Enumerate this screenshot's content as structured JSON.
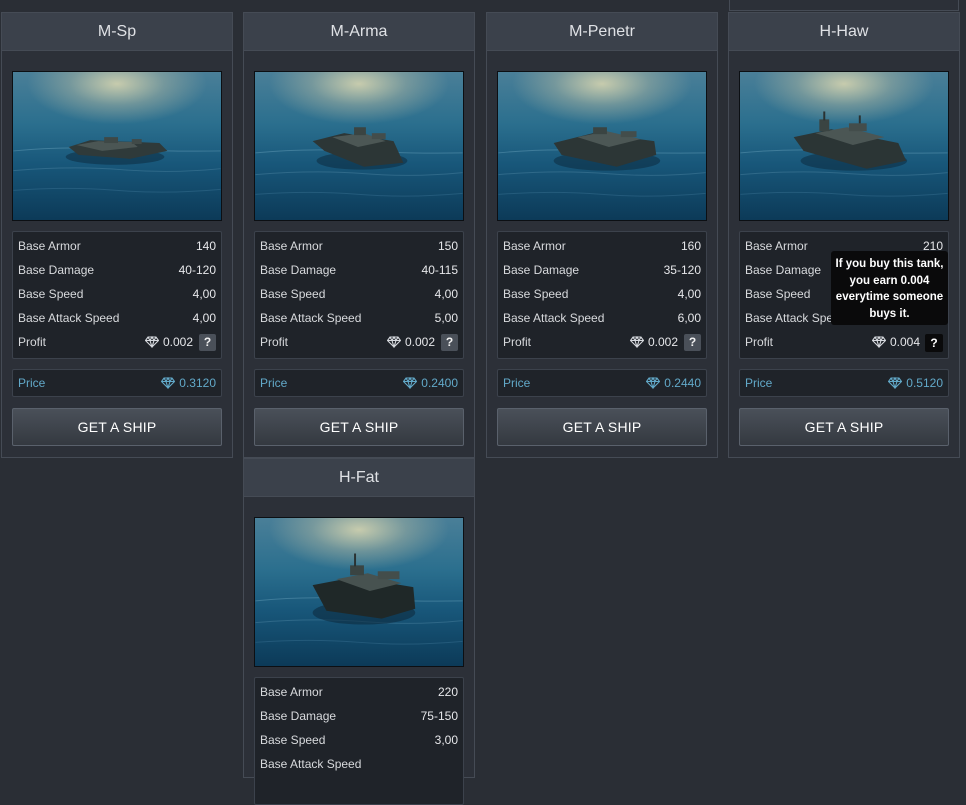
{
  "labels": {
    "base_armor": "Base Armor",
    "base_damage": "Base Damage",
    "base_speed": "Base Speed",
    "base_attack_speed": "Base Attack Speed",
    "profit": "Profit",
    "price": "Price",
    "help": "?",
    "buy_button": "GET A SHIP"
  },
  "icons": {
    "currency": "diamond-icon",
    "help": "question-mark-icon"
  },
  "colors": {
    "price": "#62a9c9",
    "accent_gem": "#cfd3d8"
  },
  "ships": [
    {
      "name": "M-Sp",
      "armor": "140",
      "damage": "40-120",
      "speed": "4,00",
      "attack_speed": "4,00",
      "profit": "0.002",
      "price": "0.3120"
    },
    {
      "name": "M-Arma",
      "armor": "150",
      "damage": "40-115",
      "speed": "4,00",
      "attack_speed": "5,00",
      "profit": "0.002",
      "price": "0.2400"
    },
    {
      "name": "M-Penetr",
      "armor": "160",
      "damage": "35-120",
      "speed": "4,00",
      "attack_speed": "6,00",
      "profit": "0.002",
      "price": "0.2440"
    },
    {
      "name": "H-Haw",
      "armor": "210",
      "damage": "",
      "speed": "",
      "attack_speed": "",
      "profit": "0.004",
      "price": "0.5120"
    },
    {
      "name": "H-Fat",
      "armor": "220",
      "damage": "75-150",
      "speed": "3,00"
    }
  ],
  "tooltip": {
    "text": "If you buy this tank, you earn 0.004 everytime someone buys it.",
    "help": "?"
  }
}
